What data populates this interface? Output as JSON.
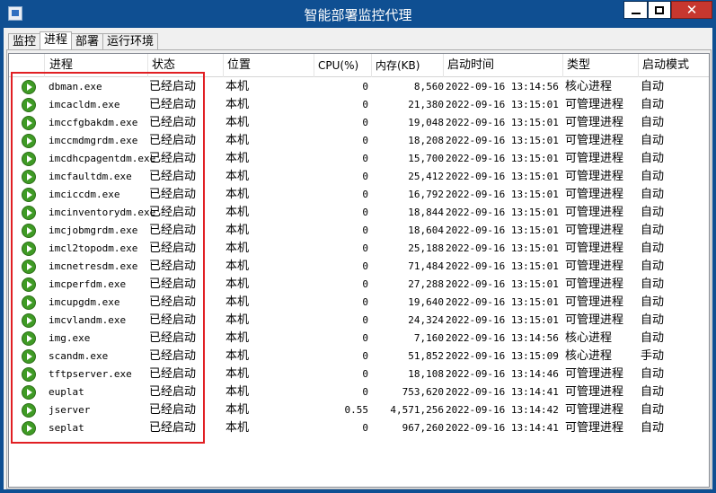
{
  "window": {
    "title": "智能部署监控代理",
    "controls": {
      "minimize": "",
      "maximize": "",
      "close": "✕"
    }
  },
  "tabs": [
    "监控",
    "进程",
    "部署",
    "运行环境"
  ],
  "active_tab": "进程",
  "columns": [
    "进程",
    "状态",
    "位置",
    "CPU(%)",
    "内存(KB)",
    "启动时间",
    "类型",
    "启动模式"
  ],
  "rows": [
    {
      "name": "dbman.exe",
      "status": "已经启动",
      "location": "本机",
      "cpu": "0",
      "mem": "8,560",
      "start": "2022-09-16 13:14:56",
      "type": "核心进程",
      "mode": "自动"
    },
    {
      "name": "imcacldm.exe",
      "status": "已经启动",
      "location": "本机",
      "cpu": "0",
      "mem": "21,380",
      "start": "2022-09-16 13:15:01",
      "type": "可管理进程",
      "mode": "自动"
    },
    {
      "name": "imccfgbakdm.exe",
      "status": "已经启动",
      "location": "本机",
      "cpu": "0",
      "mem": "19,048",
      "start": "2022-09-16 13:15:01",
      "type": "可管理进程",
      "mode": "自动"
    },
    {
      "name": "imccmdmgrdm.exe",
      "status": "已经启动",
      "location": "本机",
      "cpu": "0",
      "mem": "18,208",
      "start": "2022-09-16 13:15:01",
      "type": "可管理进程",
      "mode": "自动"
    },
    {
      "name": "imcdhcpagentdm.exe",
      "status": "已经启动",
      "location": "本机",
      "cpu": "0",
      "mem": "15,700",
      "start": "2022-09-16 13:15:01",
      "type": "可管理进程",
      "mode": "自动"
    },
    {
      "name": "imcfaultdm.exe",
      "status": "已经启动",
      "location": "本机",
      "cpu": "0",
      "mem": "25,412",
      "start": "2022-09-16 13:15:01",
      "type": "可管理进程",
      "mode": "自动"
    },
    {
      "name": "imciccdm.exe",
      "status": "已经启动",
      "location": "本机",
      "cpu": "0",
      "mem": "16,792",
      "start": "2022-09-16 13:15:01",
      "type": "可管理进程",
      "mode": "自动"
    },
    {
      "name": "imcinventorydm.exe",
      "status": "已经启动",
      "location": "本机",
      "cpu": "0",
      "mem": "18,844",
      "start": "2022-09-16 13:15:01",
      "type": "可管理进程",
      "mode": "自动"
    },
    {
      "name": "imcjobmgrdm.exe",
      "status": "已经启动",
      "location": "本机",
      "cpu": "0",
      "mem": "18,604",
      "start": "2022-09-16 13:15:01",
      "type": "可管理进程",
      "mode": "自动"
    },
    {
      "name": "imcl2topodm.exe",
      "status": "已经启动",
      "location": "本机",
      "cpu": "0",
      "mem": "25,188",
      "start": "2022-09-16 13:15:01",
      "type": "可管理进程",
      "mode": "自动"
    },
    {
      "name": "imcnetresdm.exe",
      "status": "已经启动",
      "location": "本机",
      "cpu": "0",
      "mem": "71,484",
      "start": "2022-09-16 13:15:01",
      "type": "可管理进程",
      "mode": "自动"
    },
    {
      "name": "imcperfdm.exe",
      "status": "已经启动",
      "location": "本机",
      "cpu": "0",
      "mem": "27,288",
      "start": "2022-09-16 13:15:01",
      "type": "可管理进程",
      "mode": "自动"
    },
    {
      "name": "imcupgdm.exe",
      "status": "已经启动",
      "location": "本机",
      "cpu": "0",
      "mem": "19,640",
      "start": "2022-09-16 13:15:01",
      "type": "可管理进程",
      "mode": "自动"
    },
    {
      "name": "imcvlandm.exe",
      "status": "已经启动",
      "location": "本机",
      "cpu": "0",
      "mem": "24,324",
      "start": "2022-09-16 13:15:01",
      "type": "可管理进程",
      "mode": "自动"
    },
    {
      "name": "img.exe",
      "status": "已经启动",
      "location": "本机",
      "cpu": "0",
      "mem": "7,160",
      "start": "2022-09-16 13:14:56",
      "type": "核心进程",
      "mode": "自动"
    },
    {
      "name": "scandm.exe",
      "status": "已经启动",
      "location": "本机",
      "cpu": "0",
      "mem": "51,852",
      "start": "2022-09-16 13:15:09",
      "type": "核心进程",
      "mode": "手动"
    },
    {
      "name": "tftpserver.exe",
      "status": "已经启动",
      "location": "本机",
      "cpu": "0",
      "mem": "18,108",
      "start": "2022-09-16 13:14:46",
      "type": "可管理进程",
      "mode": "自动"
    },
    {
      "name": "euplat",
      "status": "已经启动",
      "location": "本机",
      "cpu": "0",
      "mem": "753,620",
      "start": "2022-09-16 13:14:41",
      "type": "可管理进程",
      "mode": "自动"
    },
    {
      "name": "jserver",
      "status": "已经启动",
      "location": "本机",
      "cpu": "0.55",
      "mem": "4,571,256",
      "start": "2022-09-16 13:14:42",
      "type": "可管理进程",
      "mode": "自动"
    },
    {
      "name": "seplat",
      "status": "已经启动",
      "location": "本机",
      "cpu": "0",
      "mem": "967,260",
      "start": "2022-09-16 13:14:41",
      "type": "可管理进程",
      "mode": "自动"
    }
  ],
  "colors": {
    "titlebar": "#0f4f92",
    "highlight": "#e11f23",
    "status_icon": "#3f9b25",
    "close_button": "#c7372f"
  },
  "icons": {
    "app": "app-icon",
    "row_status": "play-icon"
  }
}
